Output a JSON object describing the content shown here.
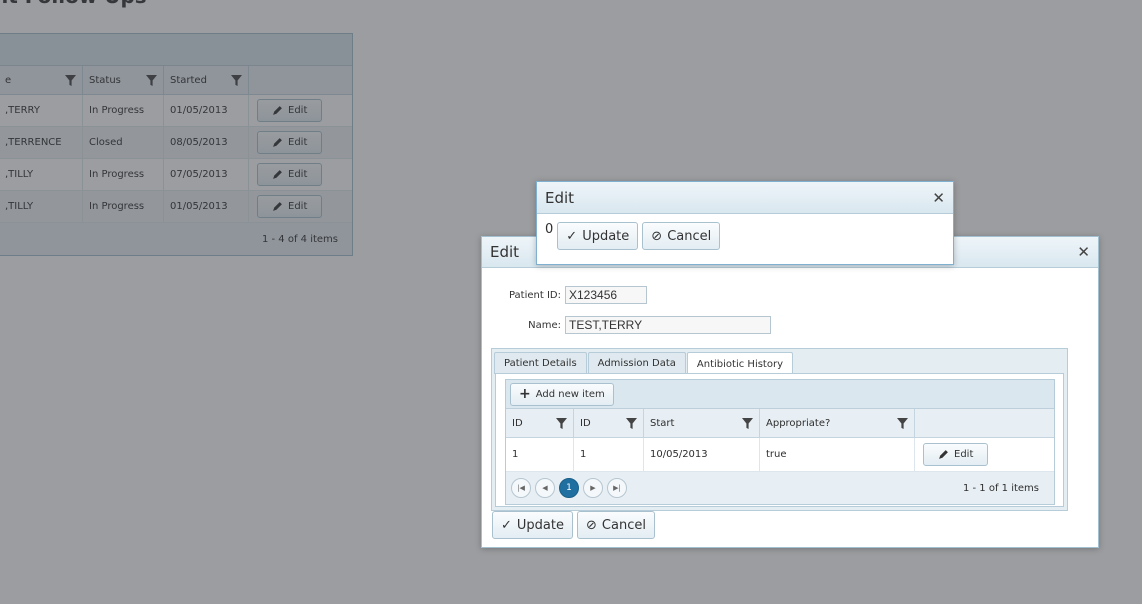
{
  "page": {
    "title": "nt Follow Ups"
  },
  "grid": {
    "columns": [
      "e",
      "Status",
      "Started",
      ""
    ],
    "rows": [
      {
        "name": ",TERRY",
        "status": "In Progress",
        "started": "01/05/2013"
      },
      {
        "name": ",TERRENCE",
        "status": "Closed",
        "started": "08/05/2013"
      },
      {
        "name": ",TILLY",
        "status": "In Progress",
        "started": "07/05/2013"
      },
      {
        "name": ",TILLY",
        "status": "In Progress",
        "started": "01/05/2013"
      }
    ],
    "edit_label": "Edit",
    "footer": "1 - 4 of 4 items"
  },
  "patient_window": {
    "title": "Edit",
    "patient_id_label": "Patient ID:",
    "patient_id_value": "X123456",
    "name_label": "Name:",
    "name_value": "TEST,TERRY",
    "tabs": [
      "Patient Details",
      "Admission Data",
      "Antibiotic History"
    ],
    "active_tab": "Antibiotic History",
    "add_new_label": "Add new item",
    "columns": [
      "ID",
      "ID",
      "Start",
      "Appropriate?",
      ""
    ],
    "rows": [
      {
        "id1": "1",
        "id2": "1",
        "start": "10/05/2013",
        "appropriate": "true"
      }
    ],
    "edit_label": "Edit",
    "current_page": "1",
    "pager_info": "1 - 1 of 1 items",
    "update_label": "Update",
    "cancel_label": "Cancel"
  },
  "edit_dialog": {
    "title": "Edit",
    "value": "0",
    "update_label": "Update",
    "cancel_label": "Cancel"
  },
  "colors": {
    "accent": "#1f6fa0",
    "overlay": "rgba(55,60,65,0.5)"
  }
}
